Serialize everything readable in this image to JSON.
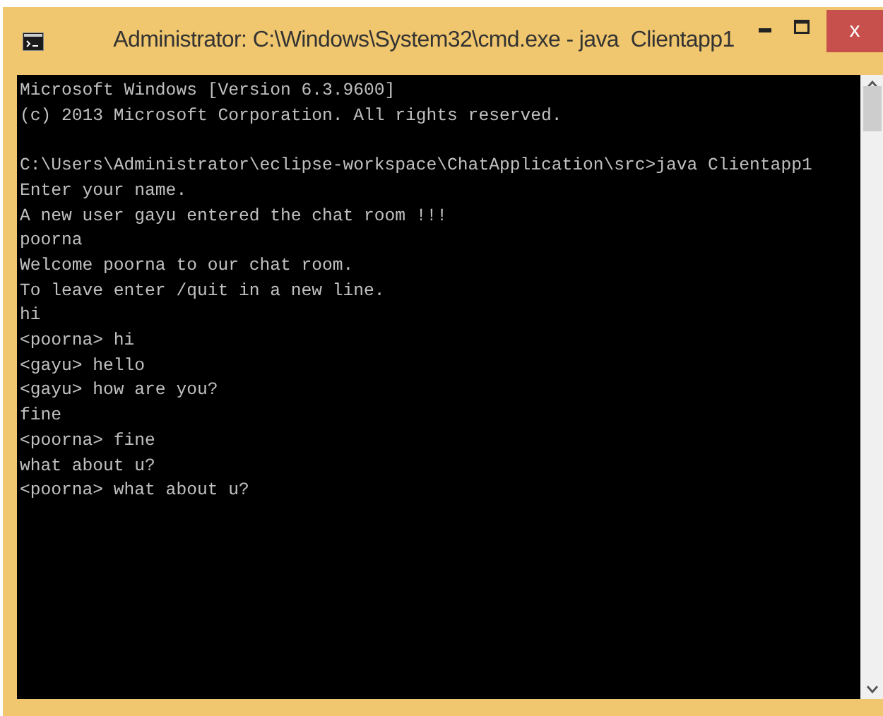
{
  "window": {
    "title": "Administrator: C:\\Windows\\System32\\cmd.exe - java  Clientapp1",
    "controls": [
      {
        "kind": "minimize"
      },
      {
        "kind": "maximize"
      },
      {
        "kind": "close",
        "label": "x"
      }
    ]
  },
  "console": {
    "lines": [
      {
        "text": "Microsoft Windows [Version 6.3.9600]"
      },
      {
        "text": "(c) 2013 Microsoft Corporation. All rights reserved."
      },
      {
        "text": "C:\\Users\\Administrator\\eclipse-workspace\\ChatApplication\\src>java Clientapp1",
        "gap_before": true
      },
      {
        "text": "Enter your name."
      },
      {
        "text": "A new user gayu entered the chat room !!!"
      },
      {
        "text": "poorna"
      },
      {
        "text": "Welcome poorna to our chat room."
      },
      {
        "text": "To leave enter /quit in a new line."
      },
      {
        "text": "hi"
      },
      {
        "text": "<poorna> hi"
      },
      {
        "text": "<gayu> hello"
      },
      {
        "text": "<gayu> how are you?"
      },
      {
        "text": "fine"
      },
      {
        "text": "<poorna> fine"
      },
      {
        "text": "what about u?"
      },
      {
        "text": "<poorna> what about u?"
      }
    ]
  }
}
